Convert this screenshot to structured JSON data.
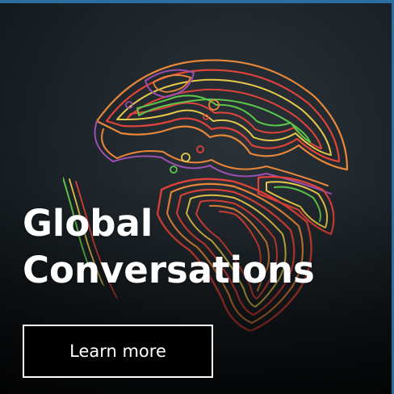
{
  "card": {
    "title_line1": "Global",
    "title_line2": "Conversations",
    "cta_label": "Learn more"
  },
  "colors": {
    "background": "#1e252a",
    "frame": "#2b6fa0",
    "contour_red": "#e0433a",
    "contour_orange": "#e8873a",
    "contour_yellow": "#e6c84a",
    "contour_green": "#5cc74a",
    "contour_purple": "#9b4fb0",
    "text": "#ffffff",
    "button_bg": "#000000"
  },
  "illustration": {
    "icon": "contour-globe-illustration"
  }
}
